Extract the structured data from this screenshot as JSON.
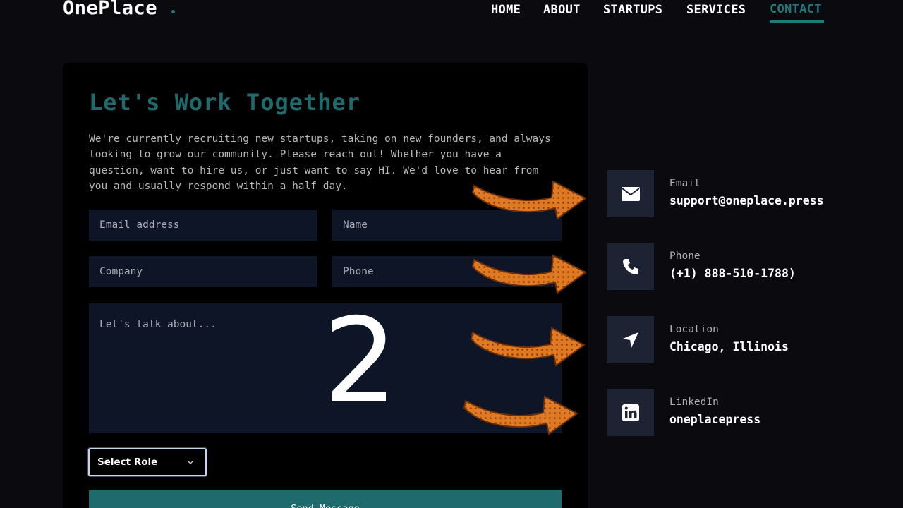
{
  "header": {
    "logo": "OnePlace",
    "nav": [
      "HOME",
      "ABOUT",
      "STARTUPS",
      "SERVICES",
      "CONTACT"
    ],
    "active_nav": "CONTACT"
  },
  "form": {
    "title": "Let's Work Together",
    "intro_lines": [
      "We're currently recruiting new startups, taking on new founders, and always",
      "looking to grow our community. Please reach out! Whether you have a",
      "question, want to hire us, or just want to say HI. We'd love to hear from",
      "you and usually respond within a half day."
    ],
    "email_placeholder": "Email address",
    "name_placeholder": "Name",
    "company_placeholder": "Company",
    "phone_placeholder": "Phone",
    "message_placeholder": "Let's talk about...",
    "role_select": "Select Role",
    "send_label": "Send Message"
  },
  "overlay_number": "2",
  "contact": [
    {
      "label": "Email",
      "value": "support@oneplace.press",
      "icon": "envelope-icon"
    },
    {
      "label": "Phone",
      "value": "(+1) 888-510-1788)",
      "icon": "phone-icon"
    },
    {
      "label": "Location",
      "value": "Chicago, Illinois",
      "icon": "location-arrow-icon"
    },
    {
      "label": "LinkedIn",
      "value": "oneplacepress",
      "icon": "linkedin-icon"
    }
  ],
  "colors": {
    "background": "#0a0a0f",
    "accent": "#1f6a6c",
    "field_bg": "#0e1527",
    "icon_box": "#1d2333",
    "arrow": "#e07a22"
  }
}
